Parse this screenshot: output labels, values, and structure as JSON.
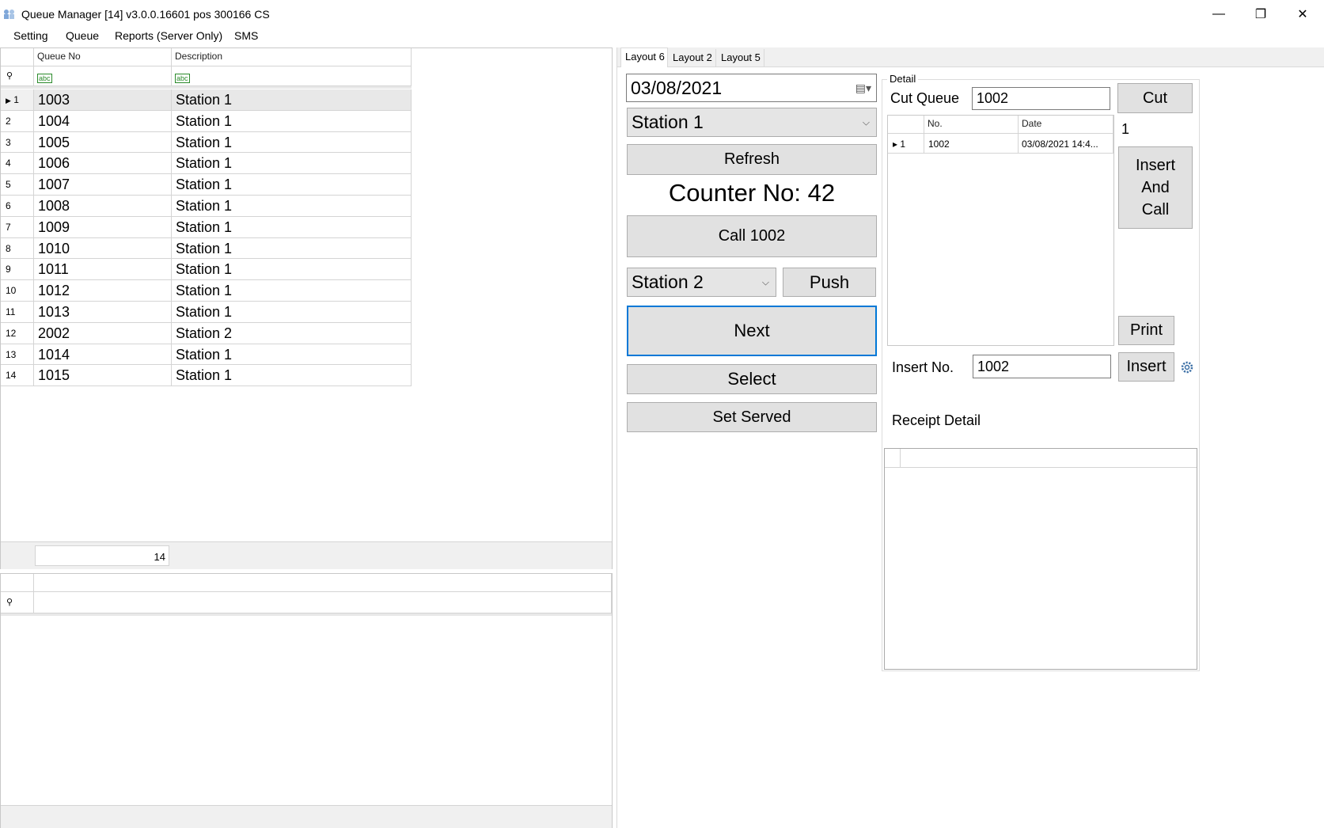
{
  "window": {
    "title": "Queue Manager [14] v3.0.0.16601 pos 300166 CS",
    "minimize_glyph": "—",
    "maximize_glyph": "❐",
    "close_glyph": "✕"
  },
  "menu": [
    "Setting",
    "Queue",
    "Reports (Server Only)",
    "SMS"
  ],
  "queue_grid": {
    "columns": [
      "Queue No",
      "Description"
    ],
    "filter_icon": "abc",
    "rows": [
      {
        "n": "1",
        "queue": "1003",
        "desc": "Station 1"
      },
      {
        "n": "2",
        "queue": "1004",
        "desc": "Station 1"
      },
      {
        "n": "3",
        "queue": "1005",
        "desc": "Station 1"
      },
      {
        "n": "4",
        "queue": "1006",
        "desc": "Station 1"
      },
      {
        "n": "5",
        "queue": "1007",
        "desc": "Station 1"
      },
      {
        "n": "6",
        "queue": "1008",
        "desc": "Station 1"
      },
      {
        "n": "7",
        "queue": "1009",
        "desc": "Station 1"
      },
      {
        "n": "8",
        "queue": "1010",
        "desc": "Station 1"
      },
      {
        "n": "9",
        "queue": "1011",
        "desc": "Station 1"
      },
      {
        "n": "10",
        "queue": "1012",
        "desc": "Station 1"
      },
      {
        "n": "11",
        "queue": "1013",
        "desc": "Station 1"
      },
      {
        "n": "12",
        "queue": "2002",
        "desc": "Station 2"
      },
      {
        "n": "13",
        "queue": "1014",
        "desc": "Station 1"
      },
      {
        "n": "14",
        "queue": "1015",
        "desc": "Station 1"
      }
    ],
    "footer_count": "14"
  },
  "tabs": [
    "Layout 6",
    "Layout 2",
    "Layout 5"
  ],
  "controls": {
    "date": "03/08/2021",
    "station_select": "Station 1",
    "refresh": "Refresh",
    "counter": "Counter No: 42",
    "call": "Call 1002",
    "push_station": "Station 2",
    "push": "Push",
    "next": "Next",
    "select": "Select",
    "set_served": "Set Served"
  },
  "detail": {
    "group_title": "Detail",
    "cut_queue_label": "Cut Queue",
    "cut_queue_value": "1002",
    "cut_button": "Cut",
    "count": "1",
    "insert_and_call": [
      "Insert",
      "And",
      "Call"
    ],
    "print": "Print",
    "insert_no_label": "Insert No.",
    "insert_no_value": "1002",
    "insert_button": "Insert",
    "receipt_detail": "Receipt Detail",
    "grid_columns": [
      "No.",
      "Date"
    ],
    "grid_rows": [
      {
        "n": "1",
        "no": "1002",
        "date": "03/08/2021 14:4..."
      }
    ]
  }
}
